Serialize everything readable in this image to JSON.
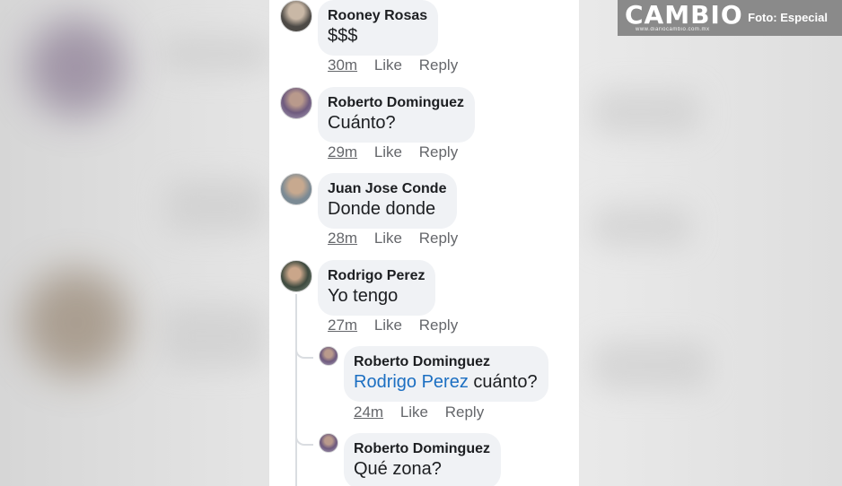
{
  "brand": {
    "logo_text": "CAMBIO",
    "logo_subtext": "www.diariocambio.com.mx",
    "photo_credit": "Foto: Especial"
  },
  "comments": [
    {
      "author": "Rooney Rosas",
      "text": "$$$",
      "time": "30m",
      "like": "Like",
      "reply": "Reply"
    },
    {
      "author": "Roberto Dominguez",
      "text": "Cuánto?",
      "time": "29m",
      "like": "Like",
      "reply": "Reply"
    },
    {
      "author": "Juan Jose Conde",
      "text": "Donde donde",
      "time": "28m",
      "like": "Like",
      "reply": "Reply"
    },
    {
      "author": "Rodrigo Perez",
      "text": "Yo tengo",
      "time": "27m",
      "like": "Like",
      "reply": "Reply"
    }
  ],
  "replies": [
    {
      "author": "Roberto Dominguez",
      "mention": "Rodrigo Perez",
      "text": "cuánto?",
      "time": "24m",
      "like": "Like",
      "reply": "Reply"
    },
    {
      "author": "Roberto Dominguez",
      "text": "Qué zona?"
    }
  ],
  "colors": {
    "bubble": "#f0f2f5",
    "mention": "#1c6fc2",
    "meta": "#65676b",
    "logo_bg": "#8a8a8a"
  }
}
